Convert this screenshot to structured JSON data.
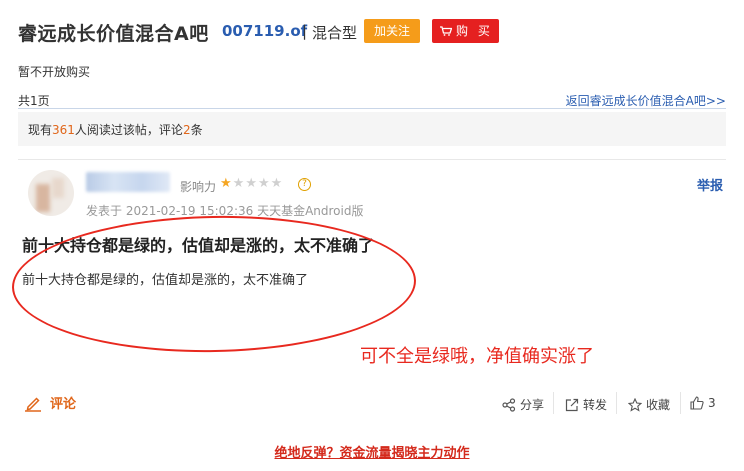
{
  "header": {
    "title": "睿远成长价值混合A吧",
    "fund_code": "007119.of",
    "separator": "|",
    "fund_type": "混合型",
    "follow_label": "加关注",
    "buy_label": "购 买"
  },
  "notice": "暂不开放购买",
  "pagination": {
    "pages_text": "共1页",
    "back_link": "返回睿远成长价值混合A吧>>"
  },
  "stats": {
    "prefix": "现有",
    "readers": "361",
    "mid": "人阅读过该帖，评论",
    "comments": "2",
    "suffix": "条"
  },
  "post": {
    "influence_label": "影响力",
    "stars": {
      "filled": 1,
      "total": 5
    },
    "help_symbol": "?",
    "report_label": "举报",
    "time_text": "发表于 2021-02-19 15:02:36 天天基金Android版",
    "title": "前十大持仓都是绿的，估值却是涨的，太不准确了",
    "body": "前十大持仓都是绿的，估值却是涨的，太不准确了"
  },
  "annotation": "可不全是绿哦，净值确实涨了",
  "actions": {
    "comment_label": "评论",
    "share_label": "分享",
    "forward_label": "转发",
    "collect_label": "收藏",
    "like_count": "3"
  },
  "promo_link": "绝地反弹？资金流量揭晓主力动作",
  "colors": {
    "link_blue": "#2a5db0",
    "orange": "#f59c1a",
    "red": "#e52020",
    "annotation_red": "#e8291f"
  }
}
